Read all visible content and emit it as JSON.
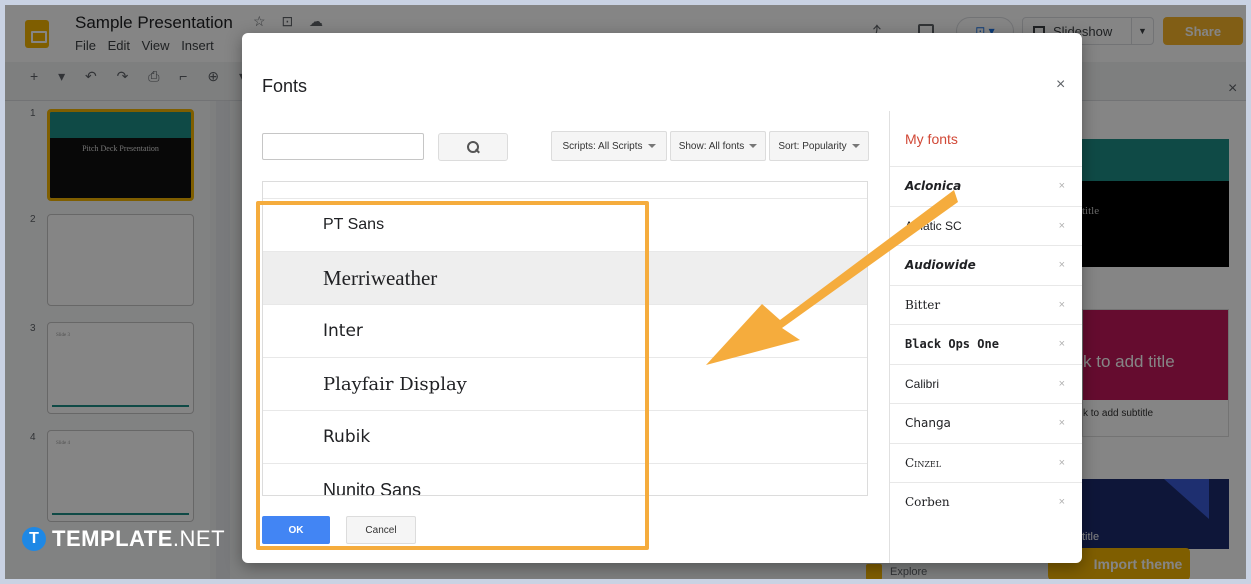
{
  "app": {
    "doc_title": "Sample Presentation",
    "menu": [
      "File",
      "Edit",
      "View",
      "Insert"
    ],
    "slideshow_label": "Slideshow",
    "share_label": "Share",
    "explore_label": "Explore",
    "import_theme_label": "Import theme",
    "slides": [
      {
        "num": "1",
        "text": "Pitch Deck Presentation"
      },
      {
        "num": "2",
        "text": ""
      },
      {
        "num": "3",
        "text": "Slide 3"
      },
      {
        "num": "4",
        "text": "Slide 4"
      }
    ],
    "themes": {
      "a_title": "title",
      "b_title": "k to add title",
      "b_subtitle": "k to add subtitle",
      "c_title": "title"
    }
  },
  "watermark": {
    "bold": "TEMPLATE",
    "light": ".NET",
    "badge": "T"
  },
  "dialog": {
    "title": "Fonts",
    "close_icon": "×",
    "search": {
      "value": "",
      "placeholder": ""
    },
    "filters": {
      "scripts": "Scripts: All Scripts",
      "show": "Show: All fonts",
      "sort": "Sort: Popularity"
    },
    "fonts": [
      {
        "name": "PT Sans",
        "family": "\"Liberation Sans\", sans-serif",
        "size": "16px"
      },
      {
        "name": "Merriweather",
        "family": "\"Liberation Serif\", serif",
        "size": "21px"
      },
      {
        "name": "Inter",
        "family": "\"DejaVu Sans\", sans-serif",
        "size": "17px"
      },
      {
        "name": "Playfair Display",
        "family": "\"DejaVu Serif\", serif",
        "size": "18px"
      },
      {
        "name": "Rubik",
        "family": "\"DejaVu Sans\", sans-serif",
        "size": "17px"
      },
      {
        "name": "Nunito Sans",
        "family": "\"Liberation Sans\", sans-serif",
        "size": "18px"
      }
    ],
    "selected_font": "Merriweather",
    "ok_label": "OK",
    "cancel_label": "Cancel",
    "my_fonts": {
      "title": "My fonts",
      "items": [
        {
          "name": "Aclonica",
          "family": "\"DejaVu Sans\", sans-serif",
          "weight": "bold",
          "style": "italic",
          "variant": "normal"
        },
        {
          "name": "Amatic SC",
          "family": "\"Liberation Sans\", sans-serif",
          "weight": "normal",
          "style": "normal",
          "variant": "normal"
        },
        {
          "name": "Audiowide",
          "family": "\"DejaVu Sans\", sans-serif",
          "weight": "bold",
          "style": "italic",
          "variant": "normal"
        },
        {
          "name": "Bitter",
          "family": "\"DejaVu Serif\", serif",
          "weight": "normal",
          "style": "normal",
          "variant": "normal"
        },
        {
          "name": "Black Ops One",
          "family": "\"DejaVu Sans Mono\", monospace",
          "weight": "bold",
          "style": "normal",
          "variant": "normal"
        },
        {
          "name": "Calibri",
          "family": "\"Liberation Sans\", sans-serif",
          "weight": "normal",
          "style": "normal",
          "variant": "normal"
        },
        {
          "name": "Changa",
          "family": "\"DejaVu Sans\", sans-serif",
          "weight": "normal",
          "style": "normal",
          "variant": "normal"
        },
        {
          "name": "Cinzel",
          "family": "\"DejaVu Serif\", serif",
          "weight": "normal",
          "style": "normal",
          "variant": "small-caps"
        },
        {
          "name": "Corben",
          "family": "\"DejaVu Serif\", serif",
          "weight": "normal",
          "style": "normal",
          "variant": "normal"
        }
      ],
      "remove_icon": "×"
    }
  },
  "colors": {
    "accent_blue": "#4285f4",
    "highlight_orange": "#f5ac3d",
    "my_fonts_red": "#d14836",
    "slides_yellow": "#f4b400",
    "theme_teal": "#1e8f86"
  }
}
